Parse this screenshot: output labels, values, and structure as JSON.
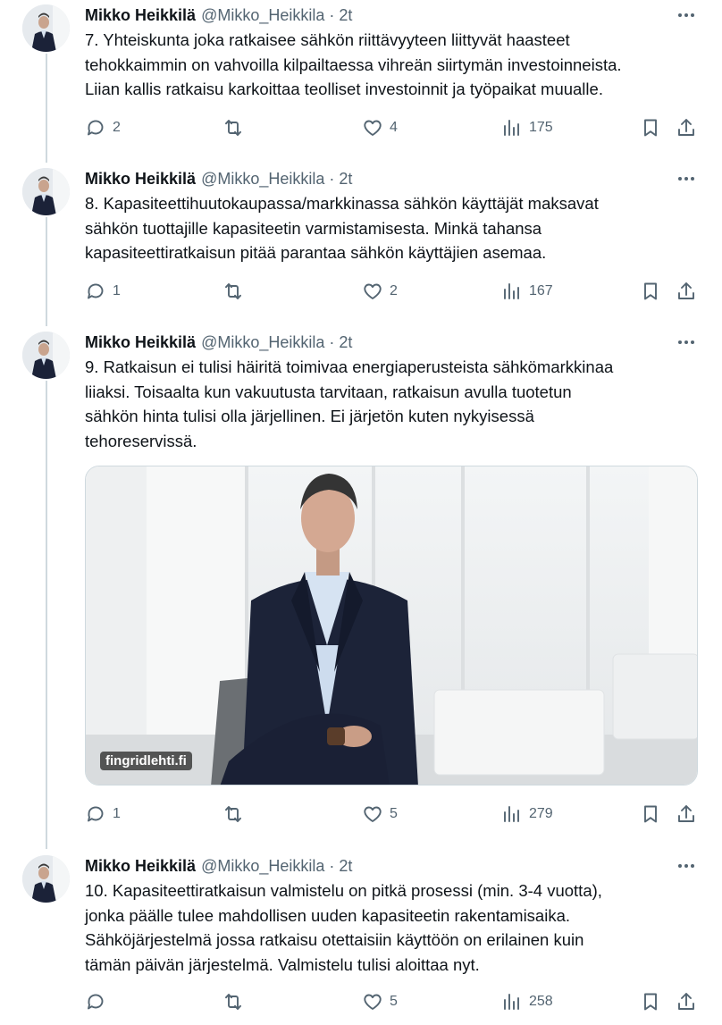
{
  "tweets": [
    {
      "author": "Mikko Heikkilä",
      "handle": "@Mikko_Heikkila",
      "time": "2t",
      "text": "7. Yhteiskunta joka ratkaisee sähkön riittävyyteen liittyvät haasteet\ntehokkaimmin on vahvoilla kilpailtaessa vihreän siirtymän investoinneista.\nLiian kallis ratkaisu karkoittaa teolliset investoinnit ja työpaikat muualle.",
      "replies": "2",
      "retweets": "",
      "likes": "4",
      "views": "175"
    },
    {
      "author": "Mikko Heikkilä",
      "handle": "@Mikko_Heikkila",
      "time": "2t",
      "text": "8. Kapasiteettihuutokaupassa/markkinassa sähkön käyttäjät maksavat\nsähkön tuottajille kapasiteetin varmistamisesta. Minkä tahansa\nkapasiteettiratkaisun pitää parantaa sähkön käyttäjien asemaa.",
      "replies": "1",
      "retweets": "",
      "likes": "2",
      "views": "167"
    },
    {
      "author": "Mikko Heikkilä",
      "handle": "@Mikko_Heikkila",
      "time": "2t",
      "text": "9. Ratkaisun ei tulisi häiritä toimivaa energiaperusteista sähkömarkkinaa\nliiaksi. Toisaalta kun vakuutusta tarvitaan, ratkaisun avulla tuotetun\nsähkön hinta tulisi olla järjellinen. Ei järjetön kuten nykyisessä\ntehoreservissä.",
      "media_label": "fingridlehti.fi",
      "replies": "1",
      "retweets": "",
      "likes": "5",
      "views": "279"
    },
    {
      "author": "Mikko Heikkilä",
      "handle": "@Mikko_Heikkila",
      "time": "2t",
      "text": "10. Kapasiteettiratkaisun valmistelu on pitkä prosessi (min. 3-4 vuotta),\njonka päälle tulee mahdollisen uuden kapasiteetin rakentamisaika.\nSähköjärjestelmä jossa ratkaisu otettaisiin käyttöön on erilainen kuin\ntämän päivän järjestelmä. Valmistelu tulisi aloittaa nyt.",
      "replies": "",
      "retweets": "",
      "likes": "5",
      "views": "258"
    }
  ],
  "icons": {
    "reply": "reply-icon",
    "retweet": "retweet-icon",
    "like": "heart-icon",
    "views": "views-icon",
    "bookmark": "bookmark-icon",
    "share": "share-icon",
    "more": "more-icon"
  },
  "colors": {
    "text": "#0f1419",
    "secondary": "#536471",
    "thread_line": "#cfd9de"
  }
}
